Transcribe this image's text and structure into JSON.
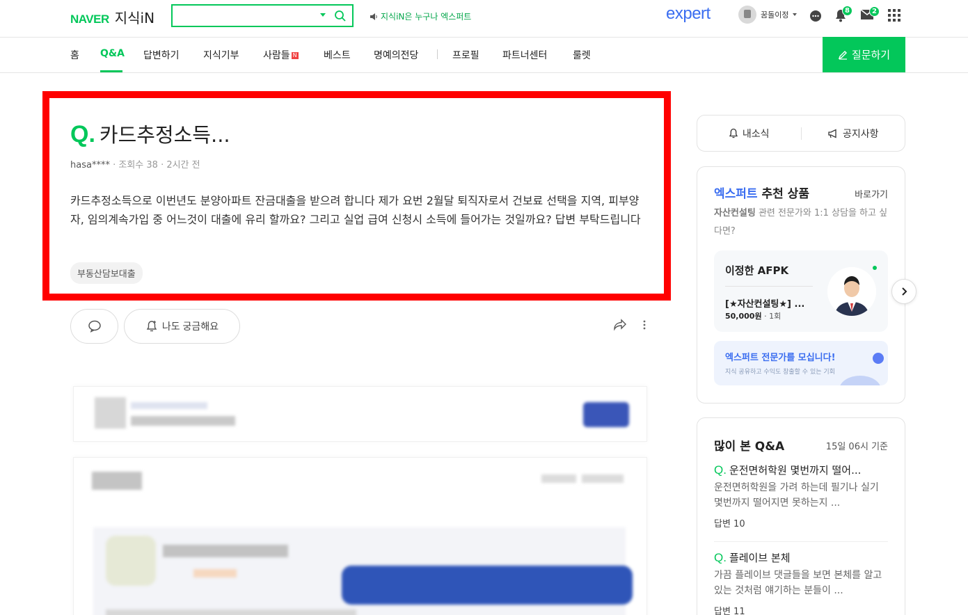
{
  "header": {
    "brand": "NAVER",
    "service": "지식iN",
    "search_placeholder": "",
    "announce": "지식iN은 누구나 엑스퍼트",
    "expert_logo": "expert",
    "username": "꿈돌이정",
    "alarm_count": "8",
    "mail_count": "2"
  },
  "nav": {
    "items": [
      "홈",
      "Q&A",
      "답변하기",
      "지식기부",
      "사람들",
      "베스트",
      "명예의전당",
      "프로필",
      "파트너센터",
      "룰렛"
    ],
    "new_badge": "N",
    "ask_button": "질문하기",
    "active_index": 1
  },
  "question": {
    "q_mark": "Q.",
    "title": "카드추정소득...",
    "author": "hasa****",
    "views": "조회수 38",
    "time": "2시간 전",
    "body": "카드추정소득으로 이번년도 분양아파트 잔금대출을 받으려 합니다 제가 요번 2월달 퇴직자로서 건보료 선택을 지역, 피부양자, 임의계속가입 중 어느것이 대출에 유리 할까요? 그리고 실업 급여 신청시 소득에 들어가는 것일까요? 답변 부탁드립니다",
    "tag": "부동산담보대출",
    "curious_label": "나도 궁금해요"
  },
  "sidebar": {
    "tab_news": "내소식",
    "tab_notice": "공지사항",
    "expert": {
      "title_blue": "엑스퍼트",
      "title_rest": "추천 상품",
      "link": "바로가기",
      "desc_bold": "자산컨설팅",
      "desc_rest": "관련 전문가와 1:1 상담을 하고 싶다면?",
      "name": "이정한 AFPK",
      "product": "[★자산컨설팅★] ...",
      "price": "50,000원",
      "count": "1회",
      "recruit_title": "엑스퍼트 전문가를 모십니다!",
      "recruit_sub": "지식 공유하고 수익도 창출할 수 있는 기회"
    },
    "popular": {
      "title": "많이 본 Q&A",
      "time": "15일 06시 기준",
      "items": [
        {
          "q": "Q.",
          "title": "운전면허학원 몇번까지 떨어...",
          "desc": "운전면허학원을 가려 하는데 필기나 실기 몇번까지 떨어지면 못하는지 ...",
          "answers": "답변 10"
        },
        {
          "q": "Q.",
          "title": "플레이브 본체",
          "desc": "가끔 플레이브 댓글들을 보면 본체를 알고 있는 것처럼 얘기하는 분들이 ...",
          "answers": "답변 11"
        }
      ]
    }
  },
  "colors": {
    "brand_green": "#03c75a",
    "expert_blue": "#3a6df0",
    "highlight_red": "#ff0000"
  }
}
